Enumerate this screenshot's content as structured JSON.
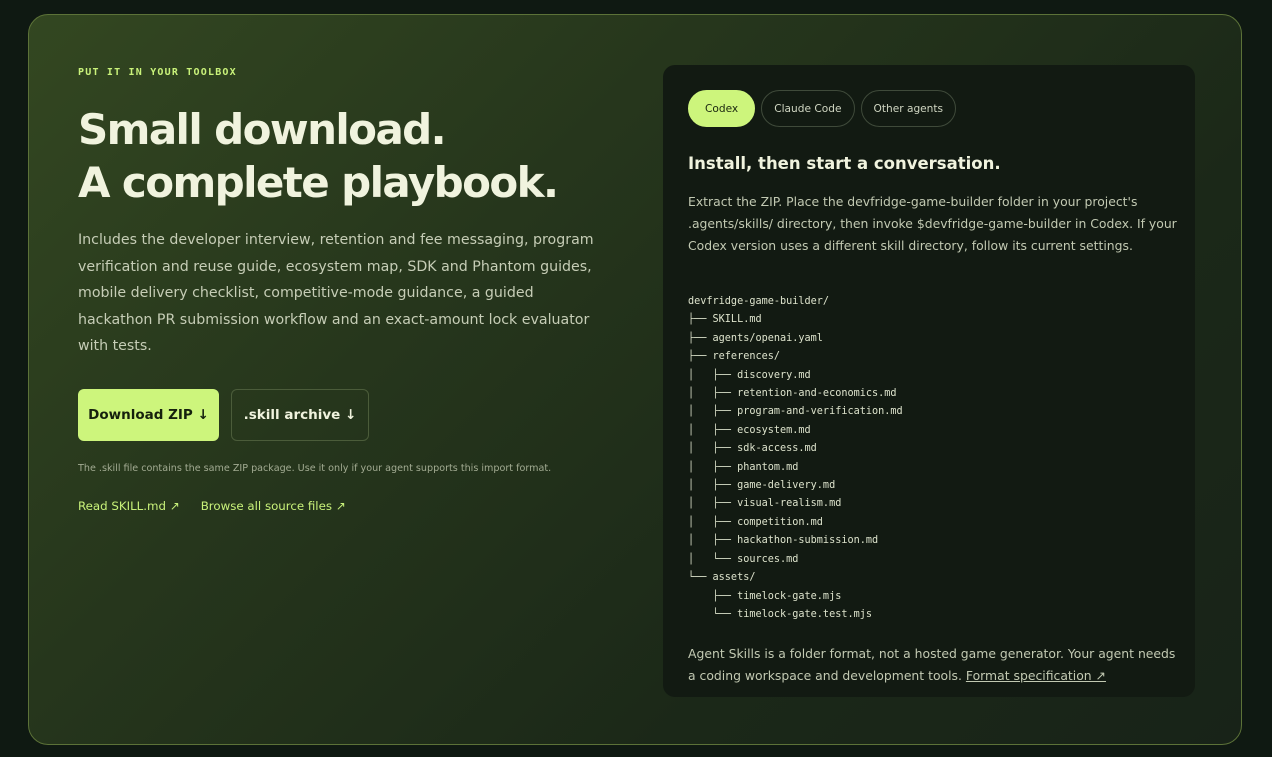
{
  "hero": {
    "eyebrow": "PUT IT IN YOUR TOOLBOX",
    "headline": [
      "Small download.",
      "A complete playbook."
    ],
    "description": "Includes the developer interview, retention and fee messaging, program verification and reuse guide, ecosystem map, SDK and Phantom guides, mobile delivery checklist, competitive-mode guidance, a guided hackathon PR submission workflow and an exact-amount lock evaluator with tests.",
    "primary_button": "Download ZIP ↓",
    "secondary_button": ".skill archive ↓",
    "note": "The .skill file contains the same ZIP package. Use it only if your agent supports this import format.",
    "links": [
      "Read SKILL.md ↗",
      "Browse all source files ↗"
    ]
  },
  "panel": {
    "tabs": [
      {
        "label": "Codex",
        "active": true
      },
      {
        "label": "Claude Code",
        "active": false
      },
      {
        "label": "Other agents",
        "active": false
      }
    ],
    "title": "Install, then start a conversation.",
    "description": "Extract the ZIP. Place the devfridge-game-builder folder in your project's .agents/skills/ directory, then invoke $devfridge-game-builder in Codex. If your Codex version uses a different skill directory, follow its current settings.",
    "tree": [
      "devfridge-game-builder/",
      "├── SKILL.md",
      "├── agents/openai.yaml",
      "├── references/",
      "│   ├── discovery.md",
      "│   ├── retention-and-economics.md",
      "│   ├── program-and-verification.md",
      "│   ├── ecosystem.md",
      "│   ├── sdk-access.md",
      "│   ├── phantom.md",
      "│   ├── game-delivery.md",
      "│   ├── visual-realism.md",
      "│   ├── competition.md",
      "│   ├── hackathon-submission.md",
      "│   └── sources.md",
      "└── assets/",
      "    ├── timelock-gate.mjs",
      "    └── timelock-gate.test.mjs"
    ],
    "footer_text": "Agent Skills is a folder format, not a hosted game generator. Your agent needs a coding workspace and development tools.",
    "footer_link": "Format specification ↗"
  },
  "colors": {
    "accent": "#cdf57c",
    "background": "#0f1912",
    "panel": "#121a12",
    "border": "#5c7238"
  }
}
